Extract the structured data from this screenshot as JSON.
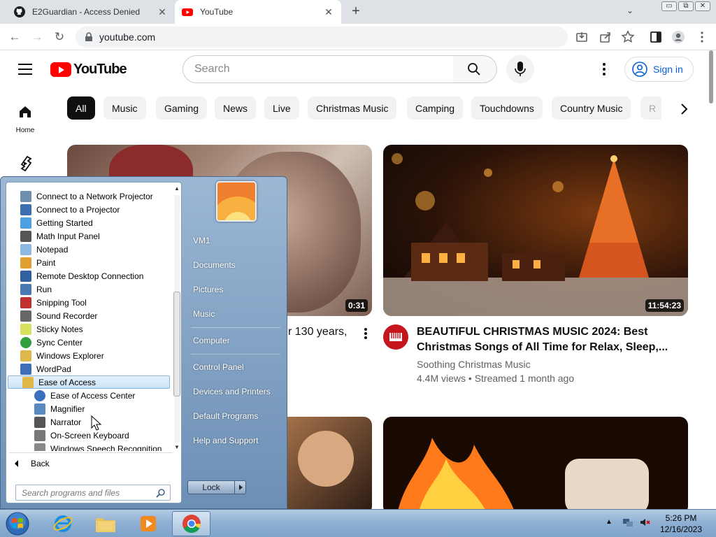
{
  "browser": {
    "tabs": [
      {
        "title": "E2Guardian - Access Denied",
        "icon": "github-icon",
        "active": false
      },
      {
        "title": "YouTube",
        "icon": "youtube-icon",
        "active": true
      }
    ],
    "new_tab_label": "+",
    "tab_search_label": "⌄",
    "window_buttons": [
      "▭",
      "⧉",
      "✕"
    ],
    "tab_close_label": "✕",
    "url": "youtube.com"
  },
  "youtube": {
    "logo_text": "YouTube",
    "search_placeholder": "Search",
    "signin_label": "Sign in",
    "home_label": "Home",
    "chips": [
      "All",
      "Music",
      "Gaming",
      "News",
      "Live",
      "Christmas Music",
      "Camping",
      "Touchdowns",
      "Country Music",
      "R"
    ],
    "videos": [
      {
        "title_partial": "r 130 years,",
        "duration": "0:31"
      },
      {
        "title": "BEAUTIFUL CHRISTMAS MUSIC 2024: Best Christmas Songs of All Time for Relax, Sleep,...",
        "channel": "Soothing Christmas Music",
        "stats": "4.4M views • Streamed 1 month ago",
        "duration": "11:54:23"
      }
    ]
  },
  "start_menu": {
    "programs": [
      {
        "label": "Connect to a Network Projector",
        "icon": "projector-icon",
        "color": "#6f8fb0"
      },
      {
        "label": "Connect to a Projector",
        "icon": "monitor-icon",
        "color": "#3d6fb0"
      },
      {
        "label": "Getting Started",
        "icon": "getting-started-icon",
        "color": "#4aa0e0"
      },
      {
        "label": "Math Input Panel",
        "icon": "math-input-icon",
        "color": "#555"
      },
      {
        "label": "Notepad",
        "icon": "notepad-icon",
        "color": "#8fb8e0"
      },
      {
        "label": "Paint",
        "icon": "paint-icon",
        "color": "#e0a030"
      },
      {
        "label": "Remote Desktop Connection",
        "icon": "remote-desktop-icon",
        "color": "#3060a0"
      },
      {
        "label": "Run",
        "icon": "run-icon",
        "color": "#4a78b0"
      },
      {
        "label": "Snipping Tool",
        "icon": "scissors-icon",
        "color": "#c03030"
      },
      {
        "label": "Sound Recorder",
        "icon": "microphone-icon",
        "color": "#666"
      },
      {
        "label": "Sticky Notes",
        "icon": "sticky-note-icon",
        "color": "#d8e060"
      },
      {
        "label": "Sync Center",
        "icon": "sync-icon",
        "color": "#30a040"
      },
      {
        "label": "Windows Explorer",
        "icon": "folder-icon",
        "color": "#e0b84a"
      },
      {
        "label": "WordPad",
        "icon": "wordpad-icon",
        "color": "#3d70b8"
      }
    ],
    "folder": {
      "label": "Ease of Access",
      "icon": "folder-icon",
      "color": "#e0b84a"
    },
    "sub_programs": [
      {
        "label": "Ease of Access Center",
        "icon": "ease-of-access-icon",
        "color": "#3a6fc0"
      },
      {
        "label": "Magnifier",
        "icon": "magnifier-icon",
        "color": "#5a8ac0"
      },
      {
        "label": "Narrator",
        "icon": "narrator-icon",
        "color": "#555"
      },
      {
        "label": "On-Screen Keyboard",
        "icon": "keyboard-icon",
        "color": "#777"
      },
      {
        "label": "Windows Speech Recognition",
        "icon": "speech-mic-icon",
        "color": "#888"
      }
    ],
    "back_label": "Back",
    "search_placeholder": "Search programs and files",
    "right_links": [
      "VM1",
      "Documents",
      "Pictures",
      "Music",
      "Computer",
      "Control Panel",
      "Devices and Printers",
      "Default Programs",
      "Help and Support"
    ],
    "lock_label": "Lock"
  },
  "taskbar": {
    "apps": [
      "internet-explorer-icon",
      "file-explorer-icon",
      "media-player-icon",
      "chrome-icon"
    ],
    "time": "5:26 PM",
    "date": "12/16/2023"
  }
}
